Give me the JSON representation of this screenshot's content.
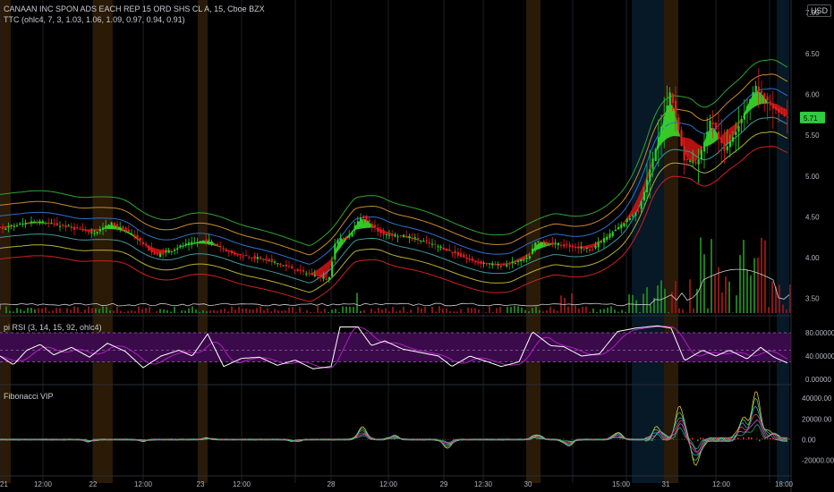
{
  "header": {
    "title": "CANAAN INC SPON ADS EACH REP 15 ORD SHS CL A, 15, Cboe BZX",
    "indicator": "TTC (ohlc4, 7, 3, 1.03, 1.06, 1.09, 0.97, 0.94, 0.91)",
    "currency": "USD"
  },
  "rsi_panel": {
    "label": "pi RSI (3, 14, 15, 92, ohlc4)"
  },
  "fib_panel": {
    "label": "Fibonacci VIP"
  },
  "chart_data": {
    "type": "candlestick",
    "price_axis": {
      "ticks": [
        "7.00",
        "6.50",
        "6.00",
        "5.50",
        "5.00",
        "4.50",
        "4.00",
        "3.50"
      ],
      "ylim": [
        3.3,
        7.1
      ],
      "last_price": "5.71"
    },
    "rsi_axis": {
      "ticks": [
        "80.00000",
        "40.00000",
        "0.00000"
      ],
      "ylim": [
        0,
        100
      ],
      "upper_line": 80,
      "middle_line": 50,
      "lower_line": 30
    },
    "fib_axis": {
      "ticks": [
        "40000.00",
        "20000.00",
        "0.00",
        "-20000.00"
      ],
      "ylim": [
        -30000,
        48000
      ]
    },
    "time_axis": {
      "ticks": [
        "21",
        "12:00",
        "22",
        "12:00",
        "23",
        "12:00",
        "28",
        "12:00",
        "29",
        "12:30",
        "30",
        "15:00",
        "31",
        "12:00",
        "18:00"
      ]
    },
    "colors": {
      "up": "#29d12b",
      "down": "#e01e1e",
      "rsi_line": "#ffffff",
      "rsi_signal": "#b020c0",
      "rsi_band": "#3a0a4a",
      "session_highlight": "#2a1a06",
      "last_price_bg": "#2ecc40"
    },
    "price_anchors": [
      {
        "x": 0,
        "p": 4.35
      },
      {
        "x": 40,
        "p": 4.45
      },
      {
        "x": 80,
        "p": 4.37
      },
      {
        "x": 105,
        "p": 4.3
      },
      {
        "x": 125,
        "p": 4.42
      },
      {
        "x": 150,
        "p": 4.28
      },
      {
        "x": 175,
        "p": 4.02
      },
      {
        "x": 205,
        "p": 4.15
      },
      {
        "x": 232,
        "p": 4.22
      },
      {
        "x": 260,
        "p": 4.05
      },
      {
        "x": 300,
        "p": 3.97
      },
      {
        "x": 340,
        "p": 3.82
      },
      {
        "x": 368,
        "p": 3.73
      },
      {
        "x": 375,
        "p": 4.2
      },
      {
        "x": 390,
        "p": 4.26
      },
      {
        "x": 405,
        "p": 4.52
      },
      {
        "x": 425,
        "p": 4.3
      },
      {
        "x": 460,
        "p": 4.25
      },
      {
        "x": 500,
        "p": 4.1
      },
      {
        "x": 530,
        "p": 3.95
      },
      {
        "x": 560,
        "p": 3.9
      },
      {
        "x": 590,
        "p": 3.98
      },
      {
        "x": 600,
        "p": 4.2
      },
      {
        "x": 620,
        "p": 4.17
      },
      {
        "x": 660,
        "p": 4.1
      },
      {
        "x": 690,
        "p": 4.35
      },
      {
        "x": 715,
        "p": 4.6
      },
      {
        "x": 735,
        "p": 5.4
      },
      {
        "x": 750,
        "p": 6.05
      },
      {
        "x": 765,
        "p": 5.2
      },
      {
        "x": 780,
        "p": 5.15
      },
      {
        "x": 795,
        "p": 5.7
      },
      {
        "x": 810,
        "p": 5.3
      },
      {
        "x": 825,
        "p": 5.6
      },
      {
        "x": 845,
        "p": 6.1
      },
      {
        "x": 862,
        "p": 5.85
      },
      {
        "x": 880,
        "p": 5.71
      }
    ],
    "rsi_anchors": [
      {
        "x": 0,
        "v": 40
      },
      {
        "x": 15,
        "v": 25
      },
      {
        "x": 30,
        "v": 50
      },
      {
        "x": 45,
        "v": 60
      },
      {
        "x": 60,
        "v": 42
      },
      {
        "x": 80,
        "v": 55
      },
      {
        "x": 100,
        "v": 38
      },
      {
        "x": 120,
        "v": 62
      },
      {
        "x": 140,
        "v": 48
      },
      {
        "x": 160,
        "v": 20
      },
      {
        "x": 180,
        "v": 40
      },
      {
        "x": 200,
        "v": 50
      },
      {
        "x": 215,
        "v": 40
      },
      {
        "x": 232,
        "v": 78
      },
      {
        "x": 250,
        "v": 22
      },
      {
        "x": 270,
        "v": 36
      },
      {
        "x": 290,
        "v": 38
      },
      {
        "x": 310,
        "v": 24
      },
      {
        "x": 330,
        "v": 33
      },
      {
        "x": 350,
        "v": 18
      },
      {
        "x": 370,
        "v": 22
      },
      {
        "x": 380,
        "v": 90
      },
      {
        "x": 400,
        "v": 90
      },
      {
        "x": 415,
        "v": 58
      },
      {
        "x": 430,
        "v": 66
      },
      {
        "x": 450,
        "v": 52
      },
      {
        "x": 470,
        "v": 46
      },
      {
        "x": 490,
        "v": 40
      },
      {
        "x": 505,
        "v": 22
      },
      {
        "x": 525,
        "v": 40
      },
      {
        "x": 545,
        "v": 30
      },
      {
        "x": 560,
        "v": 22
      },
      {
        "x": 580,
        "v": 30
      },
      {
        "x": 595,
        "v": 82
      },
      {
        "x": 615,
        "v": 58
      },
      {
        "x": 630,
        "v": 56
      },
      {
        "x": 650,
        "v": 40
      },
      {
        "x": 670,
        "v": 44
      },
      {
        "x": 690,
        "v": 82
      },
      {
        "x": 710,
        "v": 88
      },
      {
        "x": 735,
        "v": 92
      },
      {
        "x": 750,
        "v": 88
      },
      {
        "x": 765,
        "v": 32
      },
      {
        "x": 785,
        "v": 50
      },
      {
        "x": 800,
        "v": 40
      },
      {
        "x": 815,
        "v": 50
      },
      {
        "x": 835,
        "v": 35
      },
      {
        "x": 850,
        "v": 55
      },
      {
        "x": 865,
        "v": 38
      },
      {
        "x": 880,
        "v": 28
      }
    ],
    "fib_spikes": [
      {
        "x": 100,
        "v": -2000
      },
      {
        "x": 160,
        "v": -1500
      },
      {
        "x": 232,
        "v": 1500
      },
      {
        "x": 330,
        "v": -2000
      },
      {
        "x": 405,
        "v": 12000
      },
      {
        "x": 440,
        "v": 4000
      },
      {
        "x": 500,
        "v": -8000
      },
      {
        "x": 600,
        "v": 5000
      },
      {
        "x": 635,
        "v": -6000
      },
      {
        "x": 690,
        "v": 7000
      },
      {
        "x": 735,
        "v": 12000
      },
      {
        "x": 760,
        "v": 32000
      },
      {
        "x": 778,
        "v": -24000
      },
      {
        "x": 830,
        "v": 20000
      },
      {
        "x": 845,
        "v": 45000
      },
      {
        "x": 862,
        "v": 8000
      }
    ]
  }
}
